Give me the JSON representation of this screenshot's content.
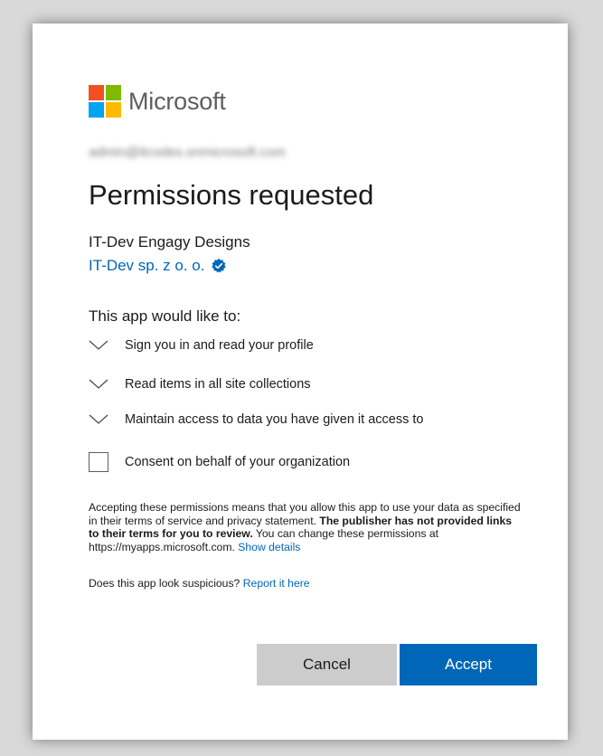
{
  "brand": {
    "name": "Microsoft"
  },
  "account": {
    "email": "admin@itcodes.onmicrosoft.com"
  },
  "page": {
    "title": "Permissions requested"
  },
  "app": {
    "name": "IT-Dev Engagy Designs",
    "publisher": "IT-Dev sp. z o. o."
  },
  "permissions": {
    "intro": "This app would like to:",
    "items": [
      {
        "label": "Sign you in and read your profile"
      },
      {
        "label": "Read items in all site collections"
      },
      {
        "label": "Maintain access to data you have given it access to"
      }
    ]
  },
  "consent": {
    "label": "Consent on behalf of your organization"
  },
  "disclaimer": {
    "text1": "Accepting these permissions means that you allow this app to use your data as specified in their terms of service and privacy statement. ",
    "bold": "The publisher has not provided links to their terms for you to review.",
    "text2": " You can change these permissions at https://myapps.microsoft.com. ",
    "link": "Show details"
  },
  "suspicious": {
    "text": "Does this app look suspicious? ",
    "link": "Report it here"
  },
  "buttons": {
    "cancel": "Cancel",
    "accept": "Accept"
  },
  "colors": {
    "accent": "#0067b8",
    "secondary_button": "#cccccc"
  }
}
